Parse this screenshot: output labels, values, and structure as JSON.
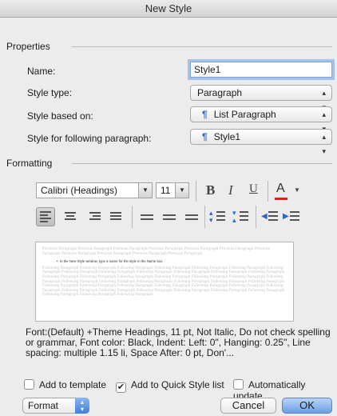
{
  "title": "New Style",
  "properties": {
    "section": "Properties",
    "name_label": "Name:",
    "name_value": "Style1",
    "type_label": "Style type:",
    "type_value": "Paragraph",
    "based_label": "Style based on:",
    "based_value": "List Paragraph",
    "following_label": "Style for following paragraph:",
    "following_value": "Style1"
  },
  "formatting": {
    "section": "Formatting",
    "font_name": "Calibri (Headings)",
    "font_size": "11",
    "bold": "B",
    "italic": "I",
    "underline": "U",
    "font_color_letter": "A",
    "preview_prev": "Previous Paragraph Previous Paragraph Previous Paragraph Previous Paragraph Previous Paragraph Previous Paragraph Previous Paragraph Previous Paragraph Previous Paragraph Previous Paragraph Previous Paragraph",
    "preview_sample": "In the New Style window, type a name for the style in the Name box.",
    "preview_follow": "Following Paragraph Following Paragraph Following Paragraph Following Paragraph Following Paragraph Following Paragraph Following Paragraph Following Paragraph Following Paragraph Following Paragraph Following Paragraph Following Paragraph Following Paragraph Following Paragraph Following Paragraph Following Paragraph Following Paragraph Following Paragraph Following Paragraph Following Paragraph Following Paragraph Following Paragraph Following Paragraph Following Paragraph Following Paragraph Following Paragraph Following Paragraph Following Paragraph Following Paragraph Following Paragraph Following Paragraph Following Paragraph Following Paragraph Following Paragraph Following Paragraph Following Paragraph Following Paragraph Following Paragraph Following Paragraph Following Paragraph Following Paragraph Following Paragraph",
    "description": "Font:(Default) +Theme Headings, 11 pt, Not Italic, Do not check spelling or grammar, Font color: Black, Indent: Left:  0\", Hanging:  0.25\", Line spacing:  multiple 1.15 li, Space After:  0 pt, Don'..."
  },
  "options": {
    "add_template": "Add to template",
    "add_quick": "Add to Quick Style list",
    "auto_update": "Automatically update"
  },
  "buttons": {
    "format": "Format",
    "cancel": "Cancel",
    "ok": "OK"
  },
  "icons": {
    "align": [
      "align-left-icon",
      "align-center-icon",
      "align-right-icon",
      "justify-icon"
    ],
    "spacing": [
      "single-spacing-icon",
      "one-half-spacing-icon",
      "double-spacing-icon"
    ],
    "paragraph": [
      "increase-paragraph-spacing-icon",
      "decrease-paragraph-spacing-icon"
    ],
    "indent": [
      "decrease-indent-icon",
      "increase-indent-icon"
    ]
  },
  "colors": {
    "font_color_bar": "#e0231f",
    "ok_button": "#7aa7e8",
    "pilcrow": "#3066c3"
  }
}
